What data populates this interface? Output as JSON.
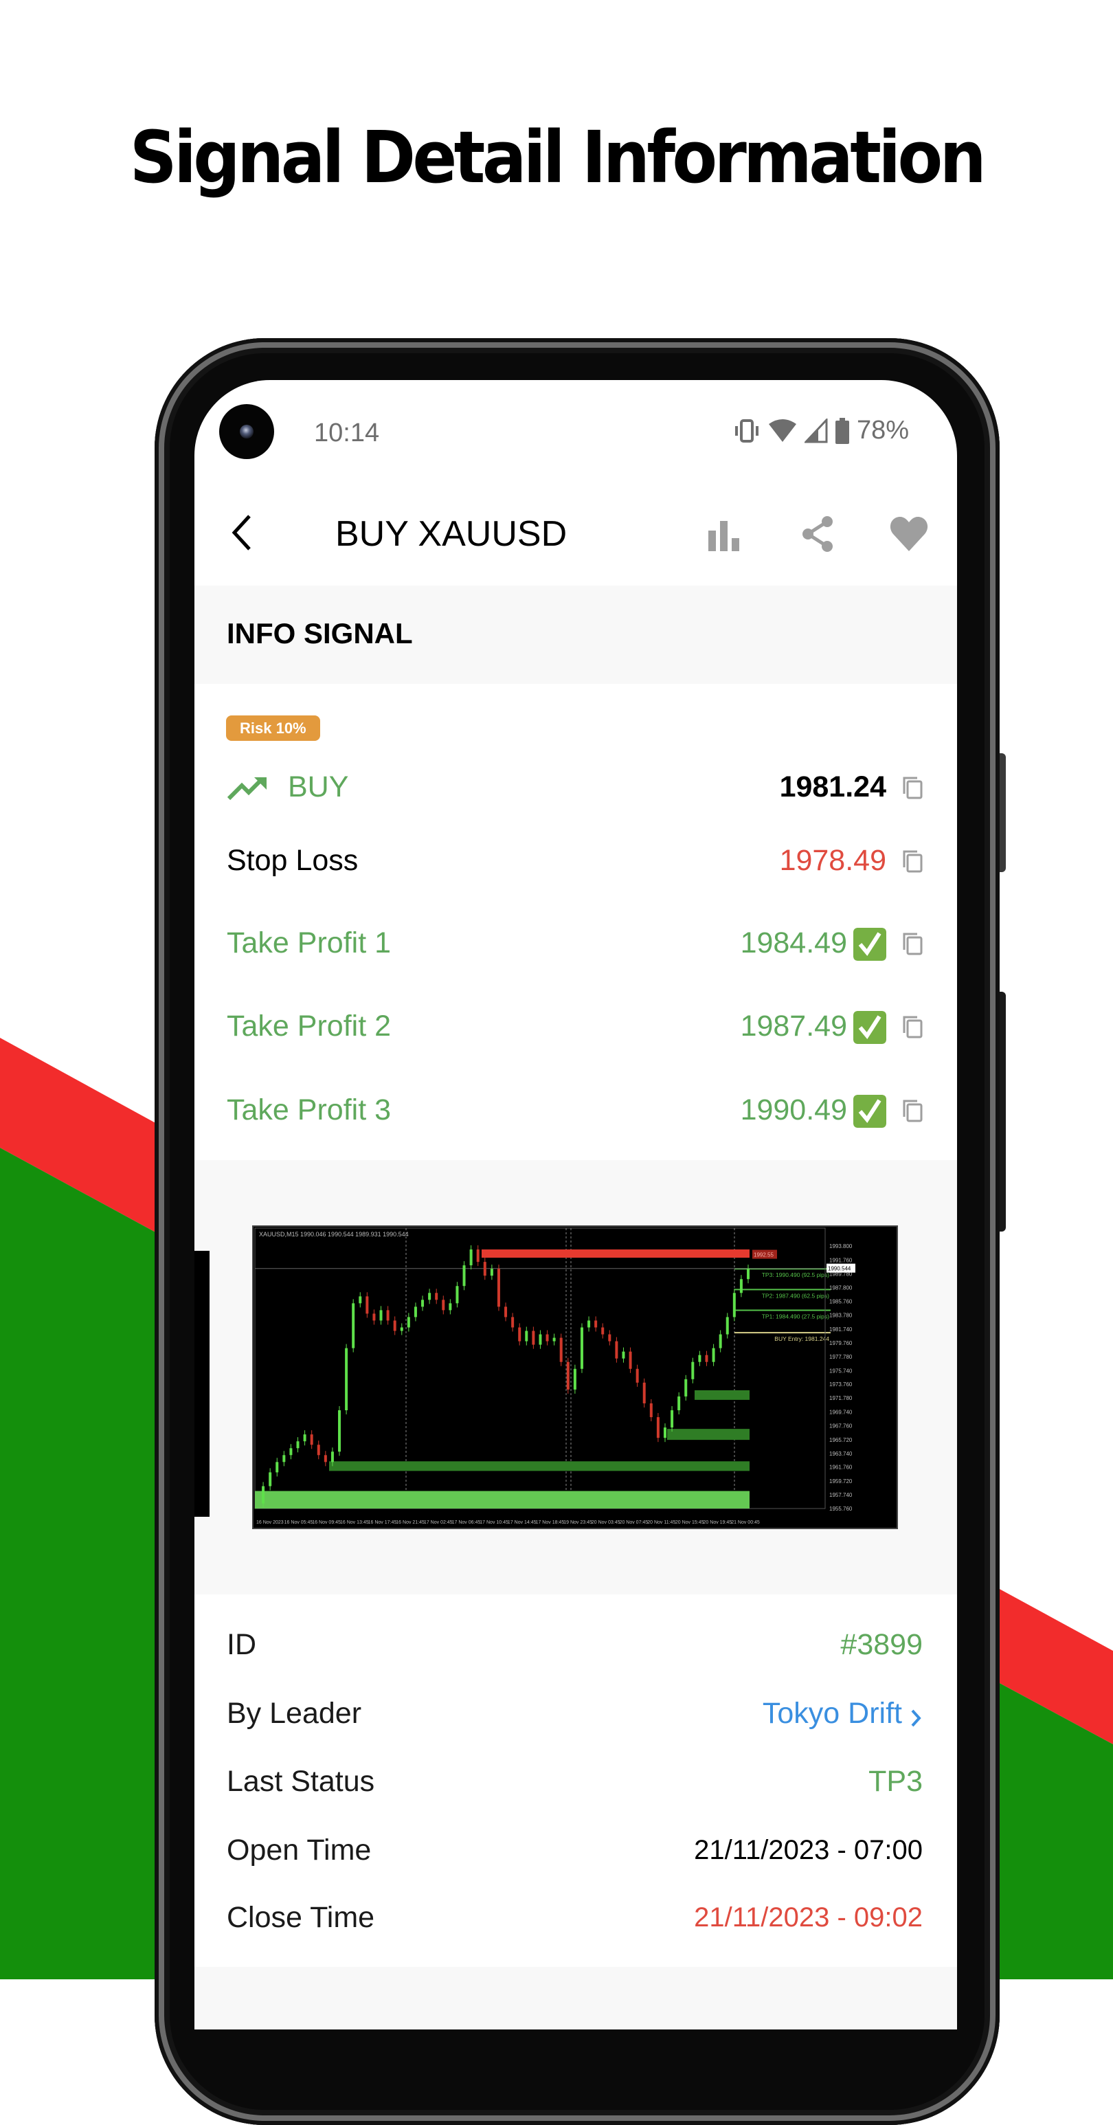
{
  "promo": {
    "headline": "Signal Detail Information",
    "stripe_red": "#f22c2c",
    "stripe_green": "#148f0c"
  },
  "status_bar": {
    "time": "10:14",
    "battery": "78%",
    "icons": [
      "vibrate-icon",
      "wifi-icon",
      "signal-icon",
      "battery-icon"
    ]
  },
  "nav": {
    "title": "BUY XAUUSD",
    "back_icon": "chevron-left-icon",
    "actions": [
      "bar-chart-icon",
      "share-icon",
      "heart-icon"
    ]
  },
  "info_section": {
    "title": "INFO SIGNAL",
    "risk_badge": "Risk 10%",
    "direction": {
      "label": "BUY",
      "icon": "trending-up-icon",
      "price": "1981.24"
    },
    "rows": [
      {
        "label": "Stop Loss",
        "value": "1978.49",
        "hit": false
      },
      {
        "label": "Take Profit 1",
        "value": "1984.49",
        "hit": true
      },
      {
        "label": "Take Profit 2",
        "value": "1987.49",
        "hit": true
      },
      {
        "label": "Take Profit 3",
        "value": "1990.49",
        "hit": true
      }
    ]
  },
  "chart_screenshot": {
    "header": "XAUUSD,M15  1990.046 1990.544 1989.931 1990.544",
    "tp3_label": "TP3: 1990.490 (92.5 pips)",
    "tp2_label": "TP2: 1987.490 (62.5 pips)",
    "tp1_label": "TP1: 1984.490 (27.5 pips)",
    "entry_label": "BUY Entry: 1981.244",
    "current_price": "1990.544",
    "resistance_label": "1992.55",
    "y_ticks": [
      "1993.800",
      "1991.760",
      "1989.780",
      "1987.800",
      "1985.760",
      "1983.780",
      "1981.740",
      "1979.760",
      "1977.780",
      "1975.740",
      "1973.760",
      "1971.780",
      "1969.740",
      "1967.760",
      "1965.720",
      "1963.740",
      "1961.760",
      "1959.720",
      "1957.740",
      "1955.760"
    ],
    "x_ticks": [
      "16 Nov 2023",
      "16 Nov 05:45",
      "16 Nov 09:45",
      "16 Nov 13:45",
      "16 Nov 17:45",
      "16 Nov 21:45",
      "17 Nov 02:45",
      "17 Nov 06:45",
      "17 Nov 10:45",
      "17 Nov 14:45",
      "17 Nov 18:45",
      "19 Nov 23:45",
      "20 Nov 03:45",
      "20 Nov 07:45",
      "20 Nov 11:45",
      "20 Nov 15:45",
      "20 Nov 19:45",
      "21 Nov 00:45"
    ],
    "price_path": [
      1956.5,
      1959,
      1961,
      1962.5,
      1963.5,
      1964.5,
      1965.5,
      1966.5,
      1965,
      1963.5,
      1962.5,
      1964,
      1970,
      1979,
      1985.5,
      1986.5,
      1984,
      1983,
      1984.5,
      1983,
      1981.5,
      1982,
      1983.5,
      1985,
      1986,
      1987,
      1986,
      1984.5,
      1985.5,
      1988,
      1991,
      1993.3,
      1991.5,
      1989.5,
      1990.5,
      1985,
      1983.5,
      1982,
      1980,
      1981.5,
      1979.5,
      1981,
      1980,
      1980.5,
      1977,
      1973,
      1976,
      1982,
      1983,
      1982,
      1981,
      1980,
      1977.5,
      1978.5,
      1976,
      1974,
      1971,
      1969,
      1966,
      1967.5,
      1970,
      1972,
      1974.5,
      1977,
      1978,
      1977,
      1979,
      1981,
      1983.5,
      1987,
      1989,
      1990.5
    ]
  },
  "details": {
    "rows": [
      {
        "label": "ID",
        "value": "#3899",
        "tone": "green"
      },
      {
        "label": "By Leader",
        "value": "Tokyo Drift",
        "tone": "blue",
        "link": true
      },
      {
        "label": "Last Status",
        "value": "TP3",
        "tone": "green"
      },
      {
        "label": "Open Time",
        "value": "21/11/2023 - 07:00",
        "tone": "black"
      },
      {
        "label": "Close Time",
        "value": "21/11/2023 - 09:02",
        "tone": "red"
      }
    ]
  },
  "colors": {
    "profit_green": "#5fa85c",
    "loss_red": "#e04b3f",
    "link_blue": "#3a8fe0",
    "risk_orange": "#e39a3d",
    "icon_gray": "#9e9e9e"
  }
}
